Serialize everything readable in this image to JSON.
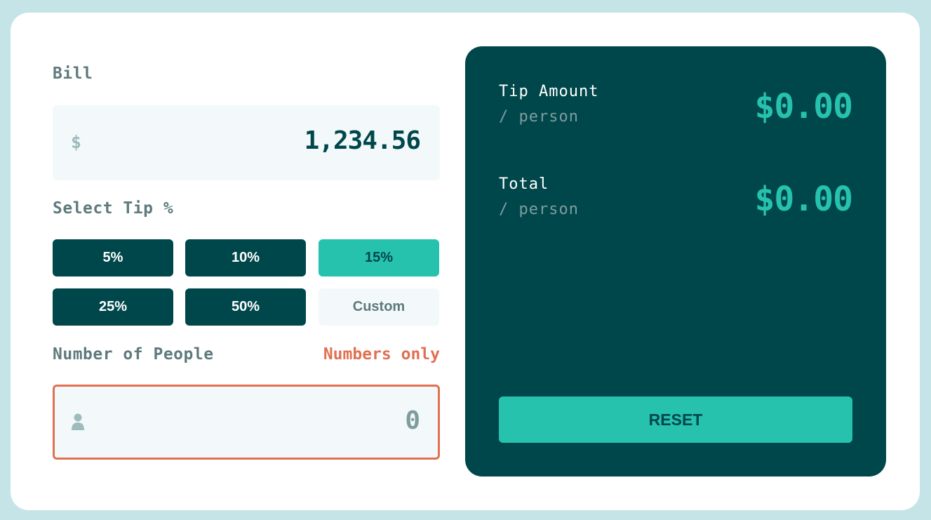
{
  "colors": {
    "background": "#c5e4e7",
    "card": "#ffffff",
    "dark_cyan": "#00474b",
    "strong_cyan": "#26c2ae",
    "grayish_cyan": "#5e7a7d",
    "light_input": "#f3f9fa",
    "error": "#e17052"
  },
  "bill": {
    "label": "Bill",
    "currency_symbol": "$",
    "value": "1,234.56"
  },
  "tip": {
    "label": "Select Tip %",
    "options": [
      {
        "label": "5%",
        "state": "default"
      },
      {
        "label": "10%",
        "state": "default"
      },
      {
        "label": "15%",
        "state": "active"
      },
      {
        "label": "25%",
        "state": "default"
      },
      {
        "label": "50%",
        "state": "default"
      }
    ],
    "custom_placeholder": "Custom"
  },
  "people": {
    "label": "Number of People",
    "error": "Numbers only",
    "icon": "person-icon",
    "value": "0"
  },
  "results": {
    "tip_amount": {
      "label": "Tip Amount",
      "sub": "/ person",
      "value": "$0.00"
    },
    "total": {
      "label": "Total",
      "sub": "/ person",
      "value": "$0.00"
    },
    "reset_label": "RESET"
  }
}
